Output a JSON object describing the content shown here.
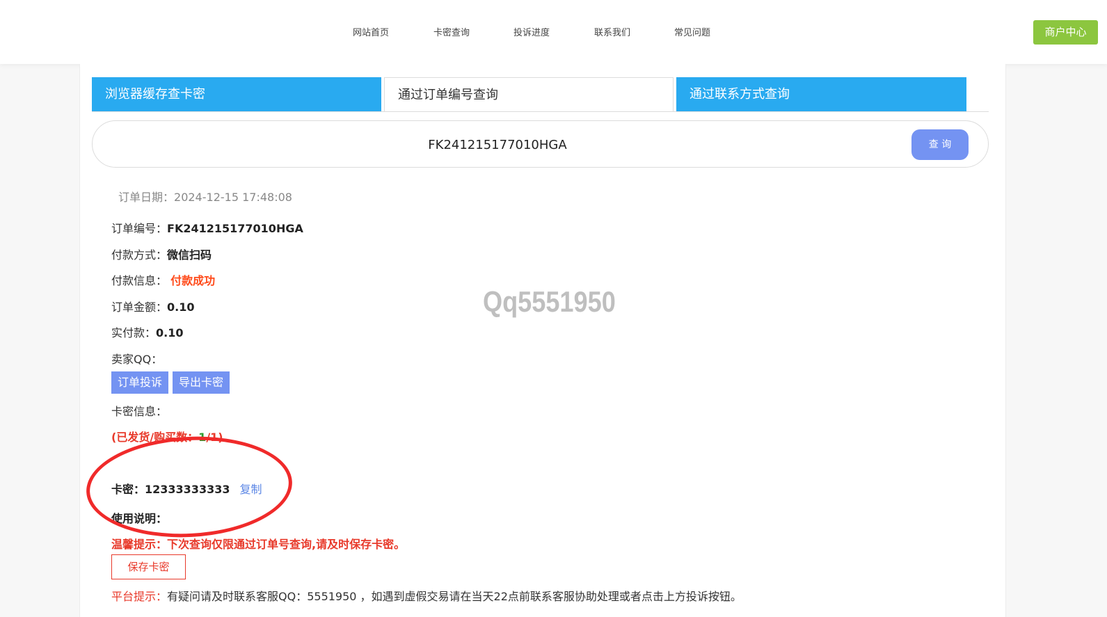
{
  "nav": {
    "items": [
      "网站首页",
      "卡密查询",
      "投诉进度",
      "联系我们",
      "常见问题"
    ],
    "merchant_label": "商户中心"
  },
  "tabs": [
    {
      "label": "浏览器缓存查卡密",
      "active": false
    },
    {
      "label": "通过订单编号查询",
      "active": true
    },
    {
      "label": "通过联系方式查询",
      "active": false
    }
  ],
  "search": {
    "value": "FK241215177010HGA",
    "button_label": "查 询"
  },
  "order": {
    "date_label": "订单日期：",
    "date": "2024-12-15 17:48:08",
    "number_label": "订单编号：",
    "number": "FK241215177010HGA",
    "pay_method_label": "付款方式：",
    "pay_method": "微信扫码",
    "pay_info_label": "付款信息：",
    "pay_info": "付款成功",
    "amount_label": "订单金额：",
    "amount": "0.10",
    "paid_label": "实付款：",
    "paid": "0.10",
    "seller_qq_label": "卖家QQ："
  },
  "actions": {
    "complain_label": "订单投诉",
    "export_label": "导出卡密"
  },
  "card": {
    "info_label": "卡密信息：",
    "count_prefix": "(已发货/购买数：",
    "count_shipped": "1",
    "count_total": "/1)",
    "code_label": "卡密：",
    "code": "12333333333",
    "copy_label": "复制",
    "usage_label": "使用说明：",
    "tip": "温馨提示：下次查询仅限通过订单号查询,请及时保存卡密。",
    "save_label": "保存卡密"
  },
  "platform": {
    "label": "平台提示：",
    "text": "有疑问请及时联系客服QQ：5551950 ，如遇到虚假交易请在当天22点前联系客服协助处理或者点击上方投诉按钮。"
  },
  "watermark": "Qq5551950",
  "colors": {
    "tab_blue": "#29aaf0",
    "button_blue": "#7493f2",
    "merchant_green": "#8cc63f",
    "alert_red": "#e8392a",
    "success_orange": "#ff4a1a",
    "count_green": "#2e9b2e"
  }
}
